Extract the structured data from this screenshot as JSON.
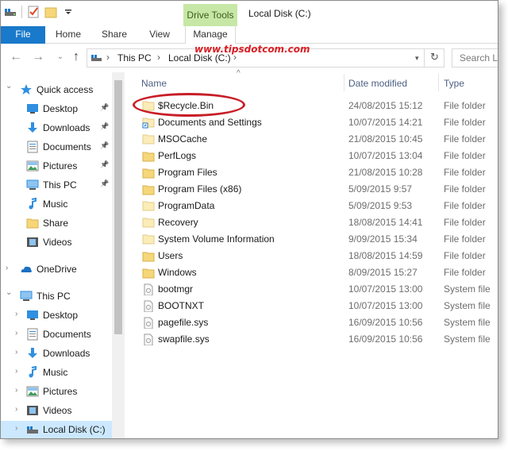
{
  "titlebar": {
    "tool_tab": "Drive Tools",
    "window_title": "Local Disk (C:)",
    "qat_icons": [
      "drive-icon",
      "properties-icon",
      "new-folder-icon",
      "qat-dropdown-icon"
    ]
  },
  "ribbon": {
    "tabs": [
      "File",
      "Home",
      "Share",
      "View",
      "Manage"
    ],
    "watermark": "www.tipsdotcom.com",
    "colors": {
      "file_tab": "#1979ca",
      "drive_tools": "#c7e7a6",
      "watermark": "#d92025"
    }
  },
  "address": {
    "crumbs": [
      "This PC",
      "Local Disk (C:)"
    ],
    "search_placeholder": "Search Lo"
  },
  "sidebar": {
    "items": [
      {
        "label": "Quick access",
        "icon": "star-icon",
        "level": 0,
        "expanded": true,
        "pinned": false
      },
      {
        "label": "Desktop",
        "icon": "desktop-icon",
        "level": 1,
        "pinned": true
      },
      {
        "label": "Downloads",
        "icon": "download-icon",
        "level": 1,
        "pinned": true
      },
      {
        "label": "Documents",
        "icon": "documents-icon",
        "level": 1,
        "pinned": true
      },
      {
        "label": "Pictures",
        "icon": "pictures-icon",
        "level": 1,
        "pinned": true
      },
      {
        "label": "This PC",
        "icon": "computer-icon",
        "level": 1,
        "pinned": true
      },
      {
        "label": "Music",
        "icon": "music-icon",
        "level": 1,
        "pinned": false
      },
      {
        "label": "Share",
        "icon": "folder-icon",
        "level": 1,
        "pinned": false
      },
      {
        "label": "Videos",
        "icon": "videos-icon",
        "level": 1,
        "pinned": false
      },
      {
        "label": "OneDrive",
        "icon": "onedrive-icon",
        "level": 0,
        "expanded": false,
        "gap": true
      },
      {
        "label": "This PC",
        "icon": "computer-icon",
        "level": 0,
        "expanded": true,
        "gap": true
      },
      {
        "label": "Desktop",
        "icon": "desktop-icon",
        "level": 1,
        "collapsed": true
      },
      {
        "label": "Documents",
        "icon": "documents-icon",
        "level": 1,
        "collapsed": true
      },
      {
        "label": "Downloads",
        "icon": "download-icon",
        "level": 1,
        "collapsed": true
      },
      {
        "label": "Music",
        "icon": "music-icon",
        "level": 1,
        "collapsed": true
      },
      {
        "label": "Pictures",
        "icon": "pictures-icon",
        "level": 1,
        "collapsed": true
      },
      {
        "label": "Videos",
        "icon": "videos-icon",
        "level": 1,
        "collapsed": true
      },
      {
        "label": "Local Disk (C:)",
        "icon": "drive-icon",
        "level": 1,
        "collapsed": true,
        "selected": true
      }
    ]
  },
  "columns": {
    "name": "Name",
    "date": "Date modified",
    "type": "Type"
  },
  "files": [
    {
      "name": "$Recycle.Bin",
      "date": "24/08/2015 15:12",
      "type": "File folder",
      "icon": "folder-hidden-icon"
    },
    {
      "name": "Documents and Settings",
      "date": "10/07/2015 14:21",
      "type": "File folder",
      "icon": "folder-shortcut-icon"
    },
    {
      "name": "MSOCache",
      "date": "21/08/2015 10:45",
      "type": "File folder",
      "icon": "folder-hidden-icon"
    },
    {
      "name": "PerfLogs",
      "date": "10/07/2015 13:04",
      "type": "File folder",
      "icon": "folder-icon"
    },
    {
      "name": "Program Files",
      "date": "21/08/2015 10:28",
      "type": "File folder",
      "icon": "folder-icon"
    },
    {
      "name": "Program Files (x86)",
      "date": "5/09/2015 9:57",
      "type": "File folder",
      "icon": "folder-icon"
    },
    {
      "name": "ProgramData",
      "date": "5/09/2015 9:53",
      "type": "File folder",
      "icon": "folder-hidden-icon"
    },
    {
      "name": "Recovery",
      "date": "18/08/2015 14:41",
      "type": "File folder",
      "icon": "folder-hidden-icon"
    },
    {
      "name": "System Volume Information",
      "date": "9/09/2015 15:34",
      "type": "File folder",
      "icon": "folder-hidden-icon"
    },
    {
      "name": "Users",
      "date": "18/08/2015 14:59",
      "type": "File folder",
      "icon": "folder-icon"
    },
    {
      "name": "Windows",
      "date": "8/09/2015 15:27",
      "type": "File folder",
      "icon": "folder-icon"
    },
    {
      "name": "bootmgr",
      "date": "10/07/2015 13:00",
      "type": "System file",
      "icon": "system-file-icon"
    },
    {
      "name": "BOOTNXT",
      "date": "10/07/2015 13:00",
      "type": "System file",
      "icon": "system-file-icon"
    },
    {
      "name": "pagefile.sys",
      "date": "16/09/2015 10:56",
      "type": "System file",
      "icon": "system-file-icon"
    },
    {
      "name": "swapfile.sys",
      "date": "16/09/2015 10:56",
      "type": "System file",
      "icon": "system-file-icon"
    }
  ]
}
